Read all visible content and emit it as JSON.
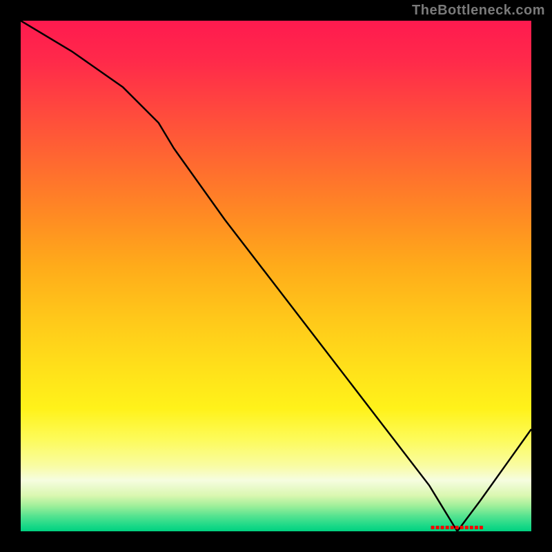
{
  "watermark": "TheBottleneck.com",
  "colors": {
    "background": "#000000",
    "curve_stroke": "#000000",
    "marker_text": "#ff0000"
  },
  "marker": {
    "label": "■■■■■■■■■■■",
    "x_frac": 0.855,
    "y_frac": 0.993
  },
  "chart_data": {
    "type": "line",
    "title": "",
    "xlabel": "",
    "ylabel": "",
    "xlim": [
      0,
      100
    ],
    "ylim": [
      0,
      100
    ],
    "x": [
      0,
      10,
      20,
      27,
      30,
      40,
      50,
      60,
      70,
      80,
      85.5,
      90,
      95,
      100
    ],
    "y": [
      100,
      94,
      87,
      80,
      75,
      61,
      48,
      35,
      22,
      9,
      0,
      6,
      13,
      20
    ],
    "series": [
      {
        "name": "bottleneck-curve",
        "x": [
          0,
          10,
          20,
          27,
          30,
          40,
          50,
          60,
          70,
          80,
          85.5,
          90,
          95,
          100
        ],
        "y": [
          100,
          94,
          87,
          80,
          75,
          61,
          48,
          35,
          22,
          9,
          0,
          6,
          13,
          20
        ]
      }
    ],
    "background_gradient_stops": [
      {
        "pos": 0.0,
        "color": "#ff1a4f"
      },
      {
        "pos": 0.5,
        "color": "#ffc71a"
      },
      {
        "pos": 0.9,
        "color": "#f6fde0"
      },
      {
        "pos": 1.0,
        "color": "#00d080"
      }
    ],
    "annotations": [
      {
        "text": "■■■■■■■■■■■",
        "x": 85.5,
        "y": 0.7,
        "color": "#ff0000"
      }
    ]
  }
}
